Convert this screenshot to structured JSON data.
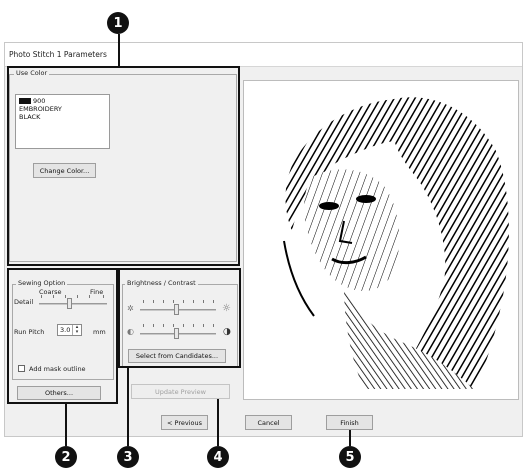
{
  "window": {
    "title": "Photo Stitch 1 Parameters"
  },
  "use_color": {
    "title": "Use Color",
    "color_swatch": "#111111",
    "color_number": "900",
    "color_brand": "EMBROIDERY",
    "color_name": "BLACK",
    "change_color_label": "Change Color..."
  },
  "sewing_option": {
    "title": "Sewing Option",
    "coarse_label": "Coarse",
    "fine_label": "Fine",
    "detail_label": "Detail",
    "detail_level": 0.5,
    "run_pitch_label": "Run Pitch",
    "run_pitch_value": "3.0",
    "run_pitch_unit": "mm",
    "add_mask_label": "Add mask outline",
    "add_mask_checked": false,
    "others_label": "Others..."
  },
  "brightness_contrast": {
    "title": "Brightness / Contrast",
    "brightness_level": 0.5,
    "contrast_level": 0.5,
    "select_candidates_label": "Select from Candidates..."
  },
  "update_preview_label": "Update Preview",
  "footer": {
    "previous_label": "< Previous",
    "cancel_label": "Cancel",
    "finish_label": "Finish"
  },
  "callouts": [
    "1",
    "2",
    "3",
    "4",
    "5"
  ]
}
